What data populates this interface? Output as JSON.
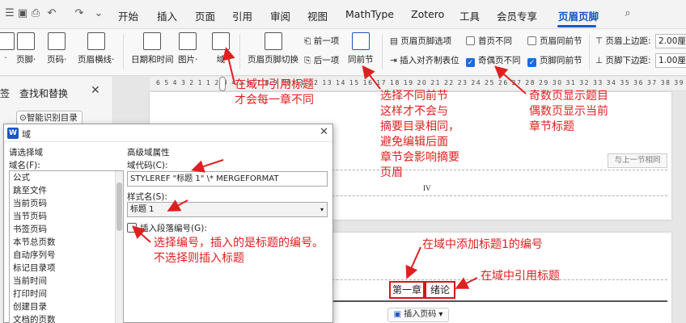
{
  "menubar": {
    "tabs": [
      "开始",
      "插入",
      "页面",
      "引用",
      "审阅",
      "视图",
      "MathType",
      "Zotero",
      "工具",
      "会员专享",
      "页眉页脚"
    ],
    "active_tab": "页眉页脚"
  },
  "ribbon": {
    "header_label": "页脚",
    "page_number_label": "页码",
    "header_line_label": "页眉横线",
    "datetime_label": "日期和时间",
    "picture_label": "图片",
    "field_label": "域",
    "switch_label": "页眉页脚切换",
    "prev_label": "前一项",
    "next_label": "后一项",
    "same_as_prev_label": "同前节",
    "options_label": "页眉页脚选项",
    "insert_tab_label": "插入对齐制表位",
    "first_page_label": "首页不同",
    "odd_even_label": "奇偶页不同",
    "header_same_label": "页眉同前节",
    "footer_same_label": "页脚同前节",
    "header_top_label": "页眉上边距:",
    "header_top_value": "2.00厘",
    "footer_bottom_label": "页脚下边距:",
    "footer_bottom_value": "1.00厘"
  },
  "left_panel": {
    "tab_label": "签",
    "find_replace": "查找和替换",
    "smart_toc": "智能识别目录"
  },
  "ruler": {
    "ticks": "6 5 4 3 2 1 1 2 3 4 5 6 7 8 9 10 11 12 13 14 15 16 17 18 19 20 21 22 23 24 25 26 27 28 29 30 31 32 33 34 35 36 37 38 39 40"
  },
  "document": {
    "same_as_prev_tag": "与上一节相同",
    "roman_page": "IV",
    "header_text_left": "第一章",
    "header_text_right": "绪论",
    "insert_page_button": "插入页码"
  },
  "dialog": {
    "title": "域",
    "choose_field_label": "请选择域",
    "field_name_label": "域名(F):",
    "advanced_label": "高级域属性",
    "field_code_label": "域代码(C):",
    "field_code_value": "STYLEREF \"标题 1\" \\* MERGEFORMAT",
    "style_name_label": "样式名(S):",
    "style_name_value": "标题 1",
    "insert_para_num_label": "插入段落编号(G):",
    "field_list": [
      "公式",
      "跳至文件",
      "当前页码",
      "当节页码",
      "书签页码",
      "本节总页数",
      "自动序列号",
      "标记目录项",
      "当前时间",
      "打印时间",
      "创建目录",
      "文档的页数",
      "文档字数的统计"
    ]
  },
  "annotations": {
    "a1": [
      "在域中引用标题",
      "才会每一章不同"
    ],
    "a2": [
      "选择不同前节",
      "这样才不会与",
      "摘要目录相同，",
      "避免编辑后面",
      "章节会影响摘要",
      "页眉"
    ],
    "a3": [
      "奇数页显示题目",
      "偶数页显示当前",
      "章节标题"
    ],
    "a4": [
      "选择编号，插入的是标题的编号。",
      "不选择则插入标题"
    ],
    "a5": [
      "在域中添加标题1的编号"
    ],
    "a6": [
      "在域中引用标题"
    ]
  },
  "colors": {
    "accent": "#1a56c4",
    "annotation_red": "#e02020",
    "checkbox_on": "#1a6be0"
  }
}
